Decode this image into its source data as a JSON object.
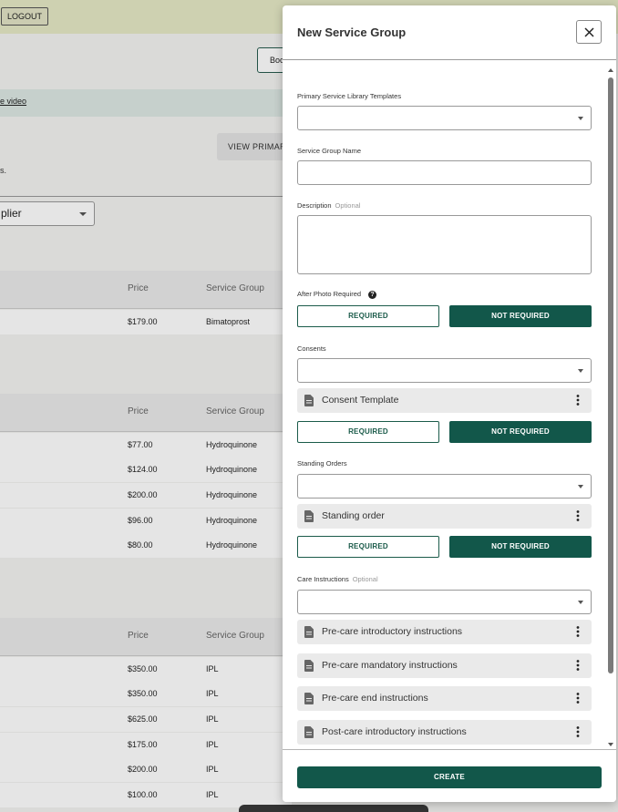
{
  "background": {
    "logout_label": "LOGOUT",
    "boo_button_label": "Boo",
    "banner_link": "e video",
    "view_button_label": "VIEW PRIMAR",
    "text_fragment": "s.",
    "supplier_select": "plier",
    "tables": [
      {
        "headers": {
          "price": "Price",
          "service_group": "Service Group"
        },
        "rows": [
          {
            "price": "$179.00",
            "group": "Bimatoprost"
          }
        ]
      },
      {
        "headers": {
          "price": "Price",
          "service_group": "Service Group"
        },
        "rows": [
          {
            "price": "$77.00",
            "group": "Hydroquinone"
          },
          {
            "price": "$124.00",
            "group": "Hydroquinone"
          },
          {
            "price": "$200.00",
            "group": "Hydroquinone"
          },
          {
            "price": "$96.00",
            "group": "Hydroquinone"
          },
          {
            "price": "$80.00",
            "group": "Hydroquinone"
          }
        ]
      },
      {
        "headers": {
          "price": "Price",
          "service_group": "Service Group"
        },
        "rows": [
          {
            "price": "$350.00",
            "group": "IPL"
          },
          {
            "price": "$350.00",
            "group": "IPL"
          },
          {
            "price": "$625.00",
            "group": "IPL"
          },
          {
            "price": "$175.00",
            "group": "IPL"
          },
          {
            "price": "$200.00",
            "group": "IPL"
          },
          {
            "price": "$100.00",
            "group": "IPL"
          }
        ]
      }
    ]
  },
  "modal": {
    "title": "New Service Group",
    "fields": {
      "templates_label": "Primary Service Library Templates",
      "name_label": "Service Group Name",
      "description_label": "Description",
      "optional_text": "Optional",
      "after_photo_label": "After Photo Required",
      "consents_label": "Consents",
      "standing_orders_label": "Standing Orders",
      "care_instructions_label": "Care Instructions"
    },
    "toggle": {
      "required": "REQUIRED",
      "not_required": "NOT REQUIRED"
    },
    "consent_chips": [
      "Consent Template"
    ],
    "standing_order_chips": [
      "Standing order"
    ],
    "care_chips": [
      "Pre-care introductory instructions",
      "Pre-care mandatory instructions",
      "Pre-care end instructions",
      "Post-care introductory instructions"
    ],
    "create_label": "CREATE"
  },
  "colors": {
    "primary": "#12574a",
    "topbar": "#e6e9c6",
    "chip_bg": "#eaeaea"
  }
}
